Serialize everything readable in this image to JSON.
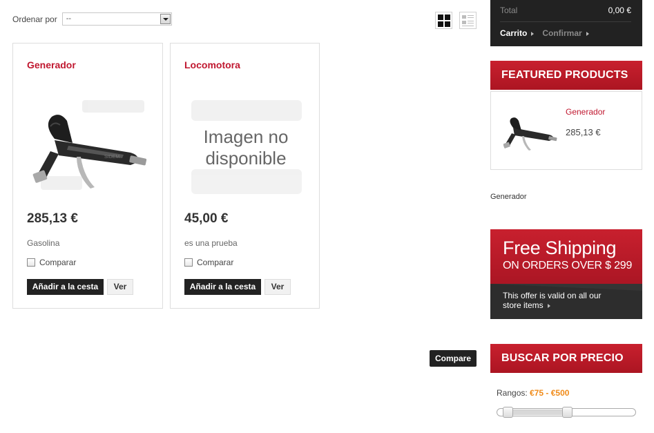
{
  "sort": {
    "label": "Ordenar por",
    "selected": "--"
  },
  "view_toggle": {
    "grid_icon": "grid-view-icon",
    "list_icon": "list-view-icon",
    "active": "grid"
  },
  "products": [
    {
      "title": "Generador",
      "price": "285,13 €",
      "description": "Gasolina",
      "compare_label": "Comparar",
      "add_label": "Añadir a la cesta",
      "view_label": "Ver",
      "image": "spray-gun"
    },
    {
      "title": "Locomotora",
      "price": "45,00 €",
      "description": "es una prueba",
      "compare_label": "Comparar",
      "add_label": "Añadir a la cesta",
      "view_label": "Ver",
      "image_text_line1": "Imagen no",
      "image_text_line2": "disponible"
    }
  ],
  "compare_button": "Compare",
  "cart": {
    "total_label": "Total",
    "total_value": "0,00 €",
    "step_cart": "Carrito",
    "step_confirm": "Confirmar"
  },
  "featured": {
    "heading": "FEATURED PRODUCTS",
    "name": "Generador",
    "price": "285,13 €"
  },
  "sidebar_text": "Generador",
  "shipping_banner": {
    "title": "Free Shipping",
    "subtitle": "ON ORDERS OVER $ 299",
    "text": "This offer is valid on all our store items"
  },
  "price_search": {
    "heading": "BUSCAR POR PRECIO",
    "range_label": "Rangos:",
    "range_value": "€75 - €500"
  },
  "colors": {
    "accent_red": "#c0172f",
    "dark": "#222222",
    "range_orange": "#f08b1a"
  }
}
